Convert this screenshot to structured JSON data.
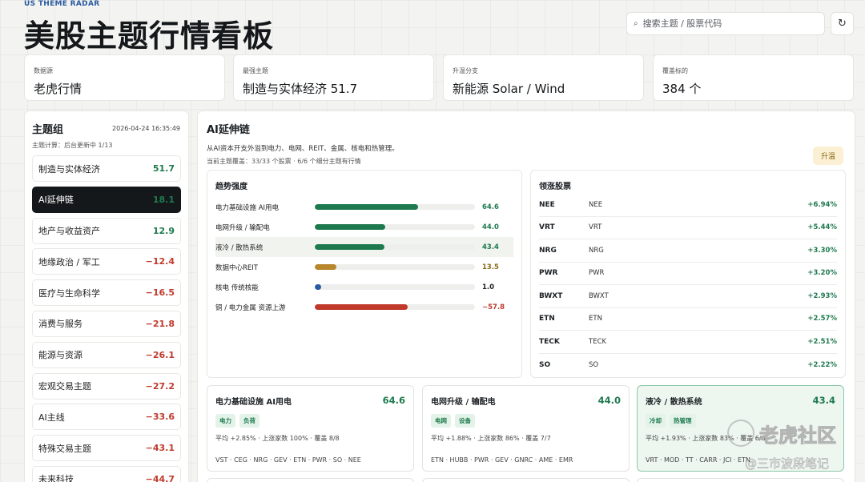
{
  "header": {
    "brand": "US THEME RADAR",
    "title": "美股主题行情看板",
    "search_placeholder": "搜索主题 / 股票代码",
    "refresh_icon": "refresh-icon"
  },
  "stats": [
    {
      "label": "数据源",
      "value": "老虎行情"
    },
    {
      "label": "最强主题",
      "value": "制造与实体经济 51.7"
    },
    {
      "label": "升温分支",
      "value": "新能源 Solar / Wind"
    },
    {
      "label": "覆盖标的",
      "value": "384 个"
    }
  ],
  "sidebar": {
    "title": "主题组",
    "timestamp": "2026-04-24 16:35:49",
    "subtitle": "主题计算：后台更新中 1/13",
    "items": [
      {
        "label": "制造与实体经济",
        "score": "51.7",
        "sign": "pos"
      },
      {
        "label": "AI延伸链",
        "score": "18.1",
        "sign": "pos",
        "active": true
      },
      {
        "label": "地产与收益资产",
        "score": "12.9",
        "sign": "pos"
      },
      {
        "label": "地缘政治 / 军工",
        "score": "−12.4",
        "sign": "neg"
      },
      {
        "label": "医疗与生命科学",
        "score": "−16.5",
        "sign": "neg"
      },
      {
        "label": "消费与服务",
        "score": "−21.8",
        "sign": "neg"
      },
      {
        "label": "能源与资源",
        "score": "−26.1",
        "sign": "neg"
      },
      {
        "label": "宏观交易主题",
        "score": "−27.2",
        "sign": "neg"
      },
      {
        "label": "AI主线",
        "score": "−33.6",
        "sign": "neg"
      },
      {
        "label": "特殊交易主题",
        "score": "−43.1",
        "sign": "neg"
      },
      {
        "label": "未来科技",
        "score": "−44.7",
        "sign": "neg"
      }
    ]
  },
  "main": {
    "title": "AI延伸链",
    "description": "从AI资本开支外溢到电力、电网、REIT、金属、核电和热管理。",
    "coverage": "当前主题覆盖：33/33 个股票 · 6/6 个细分主题有行情",
    "badge": "升温",
    "trend": {
      "title": "趋势强度",
      "rows": [
        {
          "name": "电力基础设施 AI用电",
          "value": "64.6",
          "fraction": 0.646,
          "color": "#1e7a4e",
          "highlight": false
        },
        {
          "name": "电网升级 / 输配电",
          "value": "44.0",
          "fraction": 0.44,
          "color": "#1e7a4e",
          "highlight": false
        },
        {
          "name": "液冷 / 散热系统",
          "value": "43.4",
          "fraction": 0.434,
          "color": "#1e7a4e",
          "highlight": true
        },
        {
          "name": "数据中心REIT",
          "value": "13.5",
          "fraction": 0.135,
          "color": "#b8862b",
          "highlight": false
        },
        {
          "name": "核电 传统核能",
          "value": "1.0",
          "fraction": 0.04,
          "color": "#2a5aa0",
          "highlight": false
        },
        {
          "name": "铜 / 电力金属 资源上游",
          "value": "−57.8",
          "fraction": 0.578,
          "color": "#c0392b",
          "highlight": false
        }
      ]
    },
    "leaders": {
      "title": "领涨股票",
      "rows": [
        {
          "ticker": "NEE",
          "name": "NEE",
          "change": "+6.94%"
        },
        {
          "ticker": "VRT",
          "name": "VRT",
          "change": "+5.44%"
        },
        {
          "ticker": "NRG",
          "name": "NRG",
          "change": "+3.30%"
        },
        {
          "ticker": "PWR",
          "name": "PWR",
          "change": "+3.20%"
        },
        {
          "ticker": "BWXT",
          "name": "BWXT",
          "change": "+2.93%"
        },
        {
          "ticker": "ETN",
          "name": "ETN",
          "change": "+2.57%"
        },
        {
          "ticker": "TECK",
          "name": "TECK",
          "change": "+2.51%"
        },
        {
          "ticker": "SO",
          "name": "SO",
          "change": "+2.22%"
        }
      ]
    },
    "cards": [
      {
        "title": "电力基础设施 AI用电",
        "score": "64.6",
        "tags": [
          "电力",
          "负荷"
        ],
        "stats": "平均 +2.85% · 上涨家数 100% · 覆盖 8/8",
        "tickers": "VST · CEG · NRG · GEV · ETN · PWR · SO · NEE"
      },
      {
        "title": "电网升级 / 输配电",
        "score": "44.0",
        "tags": [
          "电网",
          "设备"
        ],
        "stats": "平均 +1.88% · 上涨家数 86% · 覆盖 7/7",
        "tickers": "ETN · HUBB · PWR · GEV · GNRC · AME · EMR"
      },
      {
        "title": "液冷 / 散热系统",
        "score": "43.4",
        "tags": [
          "冷却",
          "热管理"
        ],
        "stats": "平均 +1.93% · 上涨家数 83% · 覆盖 6/6",
        "tickers": "VRT · MOD · TT · CARR · JCI · ETN"
      }
    ]
  },
  "watermark": {
    "line1": "老虎社区",
    "line2": "@三市波段笔记"
  }
}
